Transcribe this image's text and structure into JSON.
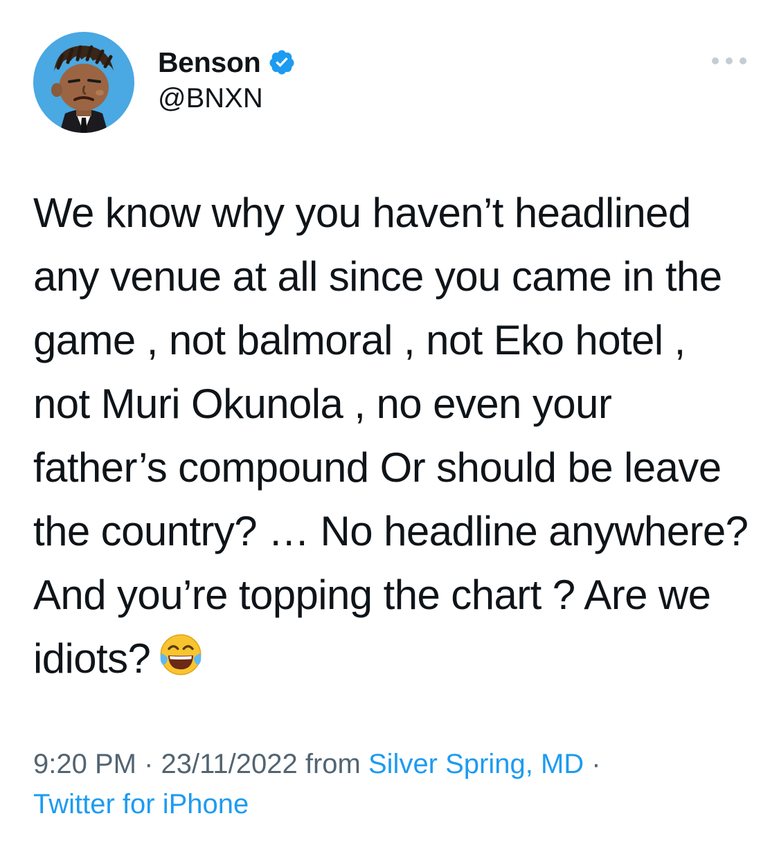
{
  "author": {
    "display_name": "Benson",
    "handle": "@BNXN",
    "verified_icon": "verified-badge-icon",
    "avatar_icon": "cartoon-avatar"
  },
  "more_icon": "ellipsis-icon",
  "tweet": {
    "text": "We know why you haven’t headlined any venue at all since you came in the game , not balmoral , not Eko hotel ,  not Muri Okunola , no even your father’s compound Or should be leave the country? … No headline anywhere? And you’re topping the chart ? Are we idiots?",
    "emoji": "face-with-tears-of-joy-icon"
  },
  "meta": {
    "time": "9:20 PM",
    "separator": " · ",
    "date": "23/11/2022",
    "from_label": " from ",
    "location": "Silver Spring, MD",
    "separator2": " · ",
    "client": "Twitter for iPhone"
  },
  "colors": {
    "link": "#1d9bf0",
    "meta_text": "#536471",
    "primary_text": "#0f1419",
    "avatar_bg": "#4aa8e2",
    "more_dots": "#c4cdd5"
  }
}
